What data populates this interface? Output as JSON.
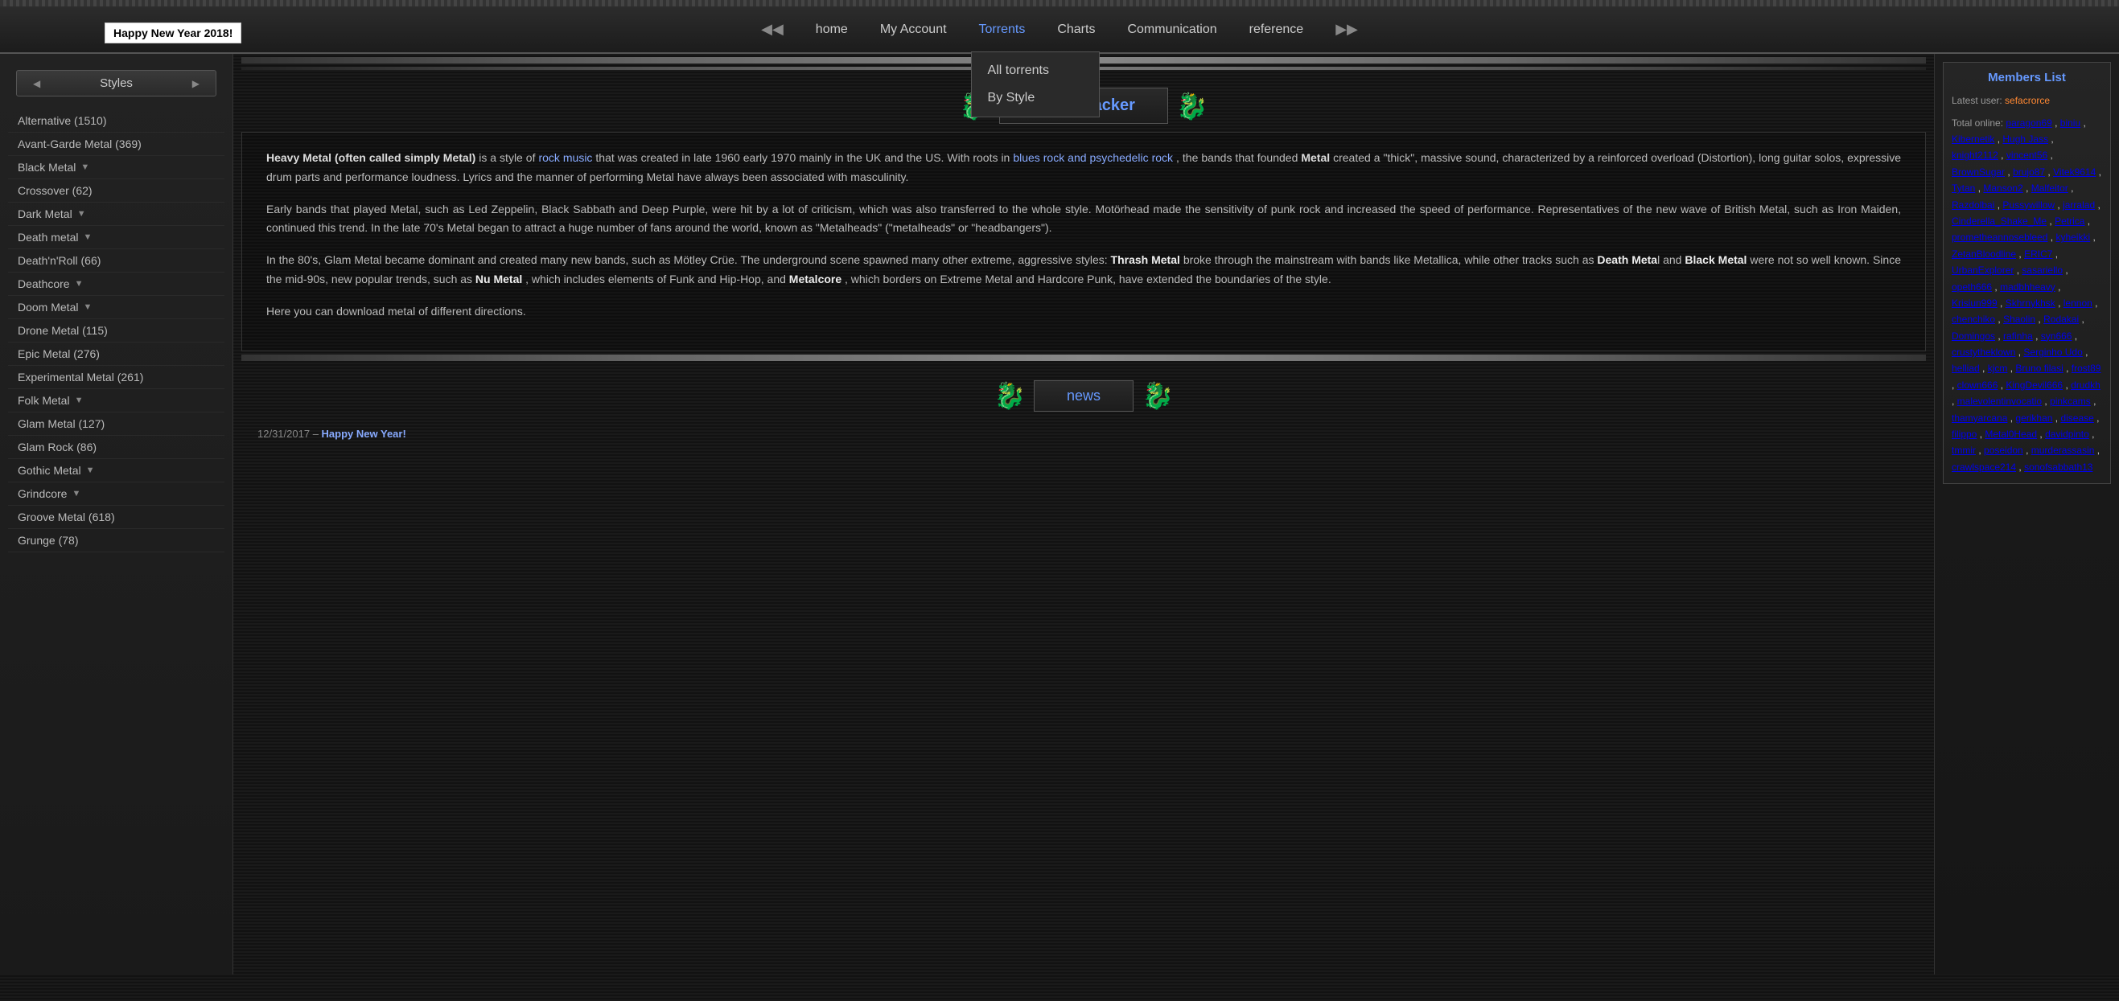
{
  "header": {
    "banner": "Happy New Year 2018!",
    "nav": {
      "items": [
        {
          "label": "home",
          "url": "#",
          "active": false
        },
        {
          "label": "My Account",
          "url": "#",
          "active": false
        },
        {
          "label": "Torrents",
          "url": "#",
          "active": true
        },
        {
          "label": "Charts",
          "url": "#",
          "active": false
        },
        {
          "label": "Communication",
          "url": "#",
          "active": false
        },
        {
          "label": "reference",
          "url": "#",
          "active": false
        }
      ],
      "torrents_dropdown": [
        {
          "label": "All torrents",
          "url": "#"
        },
        {
          "label": "By Style",
          "url": "#"
        }
      ]
    }
  },
  "sidebar": {
    "header": "Styles",
    "items": [
      {
        "label": "Alternative (1510)",
        "has_expand": false
      },
      {
        "label": "Avant-Garde Metal (369)",
        "has_expand": false
      },
      {
        "label": "Black Metal",
        "has_expand": true
      },
      {
        "label": "Crossover (62)",
        "has_expand": false
      },
      {
        "label": "Dark Metal",
        "has_expand": true
      },
      {
        "label": "Death metal",
        "has_expand": true
      },
      {
        "label": "Death'n'Roll (66)",
        "has_expand": false
      },
      {
        "label": "Deathcore",
        "has_expand": true
      },
      {
        "label": "Doom Metal",
        "has_expand": true
      },
      {
        "label": "Drone Metal (115)",
        "has_expand": false
      },
      {
        "label": "Epic Metal (276)",
        "has_expand": false
      },
      {
        "label": "Experimental Metal (261)",
        "has_expand": false
      },
      {
        "label": "Folk Metal",
        "has_expand": true
      },
      {
        "label": "Glam Metal (127)",
        "has_expand": false
      },
      {
        "label": "Glam Rock (86)",
        "has_expand": false
      },
      {
        "label": "Gothic Metal",
        "has_expand": true
      },
      {
        "label": "Grindcore",
        "has_expand": true
      },
      {
        "label": "Groove Metal (618)",
        "has_expand": false
      },
      {
        "label": "Grunge (78)",
        "has_expand": false
      }
    ]
  },
  "main": {
    "title": "Metal Tracker",
    "article": {
      "paragraph1_before": "Heavy Metal (often called simply Metal)",
      "paragraph1_mid": " is a style of ",
      "paragraph1_link": "rock music",
      "paragraph1_after": " that was created in late 1960 early 1970 mainly in the UK and the US. With roots in ",
      "paragraph1_link2": "blues rock and psychedelic rock",
      "paragraph1_end": " , the bands that founded Metal created a \"thick\", massive sound, characterized by a reinforced overload (Distortion), long guitar solos, expressive drum parts and performance loudness. Lyrics and the manner of performing Metal have always been associated with masculinity.",
      "paragraph2": "Early bands that played Metal, such as Led Zeppelin, Black Sabbath and Deep Purple, were hit by a lot of criticism, which was also transferred to the whole style. Motörhead made the sensitivity of punk rock and increased the speed of performance. Representatives of the new wave of British Metal, such as Iron Maiden, continued this trend. In the late 70's Metal began to attract a huge number of fans around the world, known as \"Metalheads\" (\"metalheads\" or \"headbangers\").",
      "paragraph3_before": "In the 80's, Glam Metal became dominant and created many new bands, such as Mötley Crüe. The underground scene spawned many other extreme, aggressive styles: ",
      "paragraph3_thrash": "Thrash Metal",
      "paragraph3_mid": " broke through the mainstream with bands like Metallica, while other tracks such as ",
      "paragraph3_death": "Death Meta",
      "paragraph3_mid2": " l and ",
      "paragraph3_black": "Black Metal",
      "paragraph3_mid3": " were not so well known. Since the mid-90s, new popular trends, such as ",
      "paragraph3_nu": "Nu Metal",
      "paragraph3_mid4": " , which includes elements of Funk and Hip-Hop, and ",
      "paragraph3_metalcore": "Metalcore",
      "paragraph3_end": " , which borders on Extreme Metal and Hardcore Punk, have extended the boundaries of the style.",
      "paragraph4": "Here you can download metal of different directions."
    },
    "news": {
      "title": "news",
      "items": [
        {
          "date": "12/31/2017",
          "separator": " – ",
          "link_text": "Happy New Year!",
          "link_url": "#"
        }
      ]
    }
  },
  "right_sidebar": {
    "members_list": {
      "title": "Members List",
      "latest_user_label": "Latest user:",
      "latest_user": "sefacrorce",
      "total_online_label": "Total online:",
      "online_users": [
        "paragon69",
        "biniu",
        "Kibernetik",
        "Hugh Jass",
        "knight2112",
        "vincent56",
        "BrownSugar",
        "brujo87",
        "Vitek9614",
        "Tytan",
        "Manson2",
        "Malfeitor",
        "Razdolbai",
        "Pussywillow",
        "jarralad",
        "Cinderella_Shake_Me",
        "Petrica",
        "prometheannosebleed",
        "kyheikki",
        "ZetanBloodline",
        "ERIC7",
        "UrbanExplorer",
        "sasariello",
        "opeth666",
        "madbhheavy",
        "Krisiun999",
        "Skhrnykhsk",
        "lennon",
        "chenchiko",
        "Shaolin",
        "Rodakai",
        "Domingos",
        "rafinha",
        "syn666",
        "crustytheklown",
        "Serginho Udo",
        "helliad",
        "kjcm",
        "Bruno filasi",
        "frost89",
        "clown666",
        "KingDevil666",
        "drudkh",
        "malevolentinvocatio",
        "pinkcams",
        "thamyarcana",
        "gerikhan",
        "disease",
        "filippo",
        "Metal0Head",
        "davidpinto",
        "tmmir",
        "poseidon",
        "murderassasin",
        "crawlspace214",
        "sonofsabbath13"
      ]
    }
  }
}
